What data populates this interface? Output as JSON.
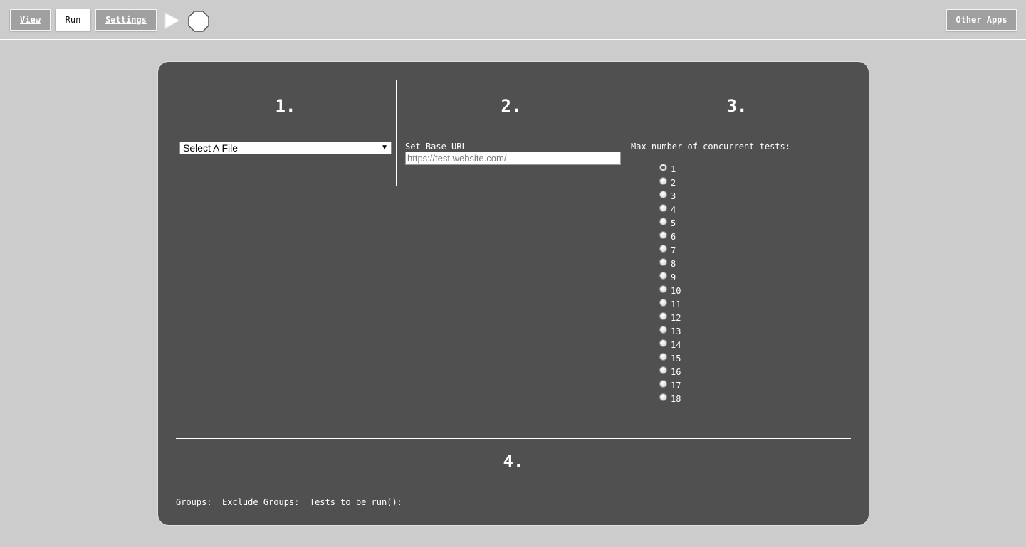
{
  "toolbar": {
    "view_label": "View",
    "run_label": "Run",
    "settings_label": "Settings",
    "other_apps_label": "Other Apps",
    "play_icon": "play-icon",
    "stop_icon": "stop-octagon-icon"
  },
  "panel": {
    "step1": "1.",
    "step2": "2.",
    "step3": "3.",
    "step4": "4.",
    "file_select": {
      "selected": "Select A File"
    },
    "base_url": {
      "label": "Set Base URL",
      "value": "",
      "placeholder": "https://test.website.com/"
    },
    "concurrency": {
      "label": "Max number of concurrent tests:",
      "options": [
        "1",
        "2",
        "3",
        "4",
        "5",
        "6",
        "7",
        "8",
        "9",
        "10",
        "11",
        "12",
        "13",
        "14",
        "15",
        "16",
        "17",
        "18"
      ],
      "selected": "1"
    },
    "groups_label": "Groups:",
    "exclude_groups_label": "Exclude Groups:",
    "tests_to_run_label": "Tests to be run():"
  },
  "colors": {
    "page_bg": "#cccccc",
    "panel_bg": "#505050",
    "button_bg": "#a0a0a0",
    "active_button_bg": "#ffffff",
    "text": "#ffffff"
  }
}
